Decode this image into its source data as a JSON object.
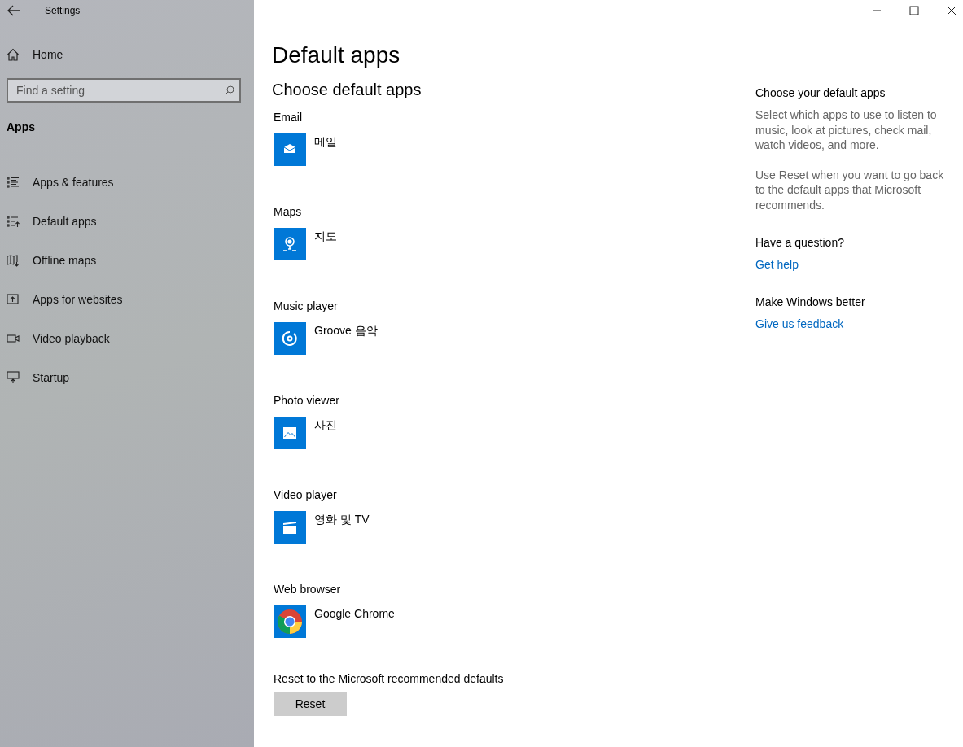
{
  "window": {
    "title": "Settings"
  },
  "sidebar": {
    "home": "Home",
    "search": {
      "placeholder": "Find a setting"
    },
    "section": "Apps",
    "items": [
      {
        "label": "Apps & features",
        "kind": "list"
      },
      {
        "label": "Default apps",
        "kind": "default"
      },
      {
        "label": "Offline maps",
        "kind": "map"
      },
      {
        "label": "Apps for websites",
        "kind": "web"
      },
      {
        "label": "Video playback",
        "kind": "video"
      },
      {
        "label": "Startup",
        "kind": "startup"
      }
    ]
  },
  "page": {
    "title": "Default apps",
    "heading": "Choose default apps",
    "categories": [
      {
        "label": "Email",
        "app": "메일",
        "kind": "mail"
      },
      {
        "label": "Maps",
        "app": "지도",
        "kind": "map"
      },
      {
        "label": "Music player",
        "app": "Groove 음악",
        "kind": "music"
      },
      {
        "label": "Photo viewer",
        "app": "사진",
        "kind": "photo"
      },
      {
        "label": "Video player",
        "app": "영화 및 TV",
        "kind": "video"
      },
      {
        "label": "Web browser",
        "app": "Google Chrome",
        "kind": "chrome"
      }
    ],
    "reset": {
      "label": "Reset to the Microsoft recommended defaults",
      "button": "Reset"
    }
  },
  "aside": {
    "sections": [
      {
        "title": "Choose your default apps",
        "paragraphs": [
          "Select which apps to use to listen to music, look at pictures, check mail, watch videos, and more.",
          "Use Reset when you want to go back to the default apps that Microsoft recommends."
        ]
      },
      {
        "title": "Have a question?",
        "link": "Get help"
      },
      {
        "title": "Make Windows better",
        "link": "Give us feedback"
      }
    ]
  }
}
